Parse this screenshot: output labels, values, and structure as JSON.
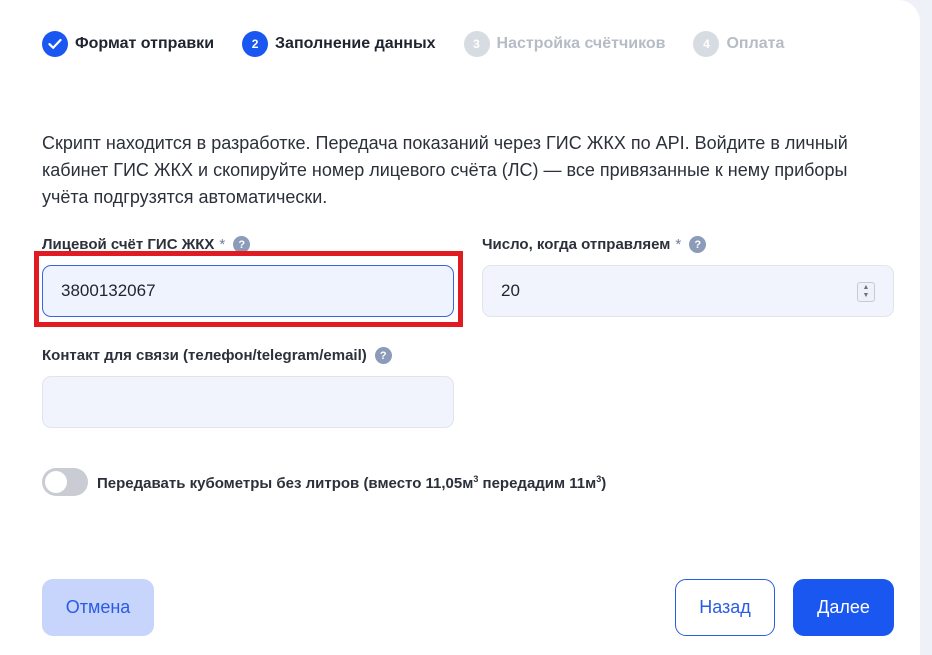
{
  "stepper": {
    "steps": [
      {
        "number": "",
        "label": "Формат отправки",
        "state": "done"
      },
      {
        "number": "2",
        "label": "Заполнение данных",
        "state": "current"
      },
      {
        "number": "3",
        "label": "Настройка счётчиков",
        "state": "pending"
      },
      {
        "number": "4",
        "label": "Оплата",
        "state": "pending"
      }
    ]
  },
  "description": "Скрипт находится в разработке. Передача показаний через ГИС ЖКХ по API. Войдите в личный кабинет ГИС ЖКХ и скопируйте номер лицевого счёта (ЛС) — все привязанные к нему приборы учёта подгрузятся автоматически.",
  "form": {
    "account": {
      "label": "Лицевой счёт ГИС ЖКХ",
      "required": "*",
      "value": "3800132067"
    },
    "send_day": {
      "label": "Число, когда отправляем",
      "required": "*",
      "value": "20"
    },
    "contact": {
      "label": "Контакт для связи (телефон/telegram/email)",
      "value": ""
    },
    "help_glyph": "?"
  },
  "toggle": {
    "label_prefix": "Передавать кубометры без литров (вместо 11,05м",
    "sup1": "3",
    "label_middle": " передадим 11м",
    "sup2": "3",
    "label_suffix": ")",
    "checked": false
  },
  "buttons": {
    "cancel": "Отмена",
    "back": "Назад",
    "next": "Далее"
  },
  "colors": {
    "accent": "#1a56f0",
    "highlight": "#e11b22"
  }
}
